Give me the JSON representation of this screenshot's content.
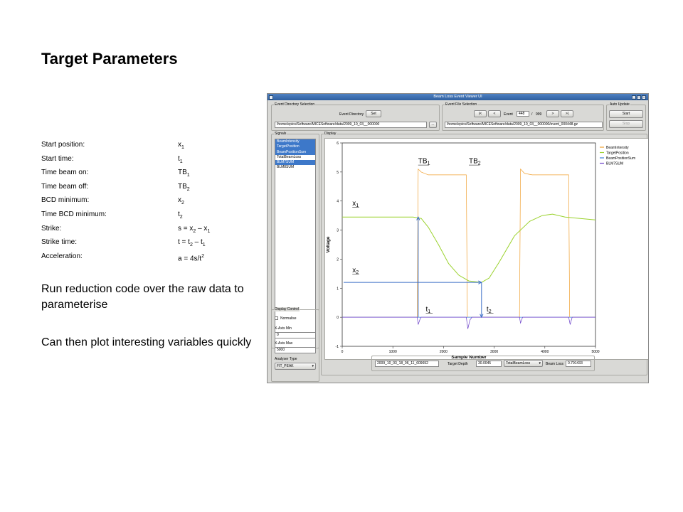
{
  "slide": {
    "title": "Target Parameters",
    "parameters": [
      {
        "label": "Start position:",
        "value": "x1"
      },
      {
        "label": "Start time:",
        "value": "t1"
      },
      {
        "label": "Time beam on:",
        "value": "TB1"
      },
      {
        "label": "Time beam off:",
        "value": "TB2"
      },
      {
        "label": "BCD minimum:",
        "value": "x2"
      },
      {
        "label": "Time BCD minimum:",
        "value": "t2"
      },
      {
        "label": "Strike:",
        "value": "s = x2 – x1"
      },
      {
        "label": "Strike time:",
        "value": "t = t2 – t1"
      },
      {
        "label": "Acceleration:",
        "value": "a = 4s/t2"
      }
    ],
    "note_run": "Run reduction code over the raw data to parameterise",
    "note_plot": "Can then plot interesting variables quickly"
  },
  "app": {
    "window_title": "Beam Loss Event Viewer UI",
    "event_directory": {
      "group_label": "Event Directory Selection",
      "label": "Event Directory",
      "set_button": "Set",
      "path": "/home/epics/Software/MICESoftware/data/2009_10_03__000000",
      "browse_button": "..."
    },
    "event_file": {
      "group_label": "Event File Selection",
      "first_button": "|<",
      "prev_button": "<",
      "event_label": "Event",
      "event_number": "448",
      "separator": "/",
      "event_total": "999",
      "next_button": ">",
      "last_button": ">|",
      "path": "/home/epics/Software/MICESoftware/data/2009_10_03__000000/event_000448.gz",
      "browse_button": "..."
    },
    "auto_update": {
      "group_label": "Auto Update",
      "start_button": "Start",
      "stop_button": "Stop"
    },
    "signals": {
      "group_label": "Signals",
      "items": [
        "BeamIntensity",
        "TargetPosition",
        "BeamPositionSum",
        "TotalBeamLoss",
        "BLM7SUM",
        "BLM8SUM"
      ],
      "selected": [
        "BeamIntensity",
        "TargetPosition",
        "BeamPositionSum",
        "BLM7SUM"
      ]
    },
    "display": {
      "group_label": "Display"
    },
    "display_control": {
      "group_label": "Display Control",
      "normalise_label": "Normalise",
      "normalise_checked": false,
      "xmin_label": "X-Axis Min",
      "xmin_value": "0",
      "xmax_label": "X-Axis Max",
      "xmax_value": "5000",
      "analyser_label": "Analyser Type",
      "analyser_value": "FIT_PEAK"
    },
    "status": {
      "timestamp": "2009_10_03_18_06_11_609652",
      "target_depth_label": "Target Depth",
      "target_depth_value": "30.0045",
      "loss_select": "TotalBeamLoss",
      "beam_loss_label": "Beam Loss",
      "beam_loss_value": "0.791433"
    }
  },
  "chart_data": {
    "type": "line",
    "xlabel": "Sample Number",
    "ylabel": "Voltage",
    "xlim": [
      0,
      5000
    ],
    "ylim": [
      -1,
      6
    ],
    "xticks": [
      "0",
      "1000",
      "2000",
      "3000",
      "4000",
      "5000"
    ],
    "yticks": [
      "-1",
      "0",
      "1",
      "2",
      "3",
      "4",
      "5",
      "6"
    ],
    "legend_position": "top-right",
    "series": [
      {
        "name": "BeamIntensity",
        "color": "#f0a030",
        "points": [
          [
            0,
            0
          ],
          [
            1480,
            0
          ],
          [
            1500,
            5.1
          ],
          [
            1560,
            5.0
          ],
          [
            1700,
            4.9
          ],
          [
            2450,
            4.9
          ],
          [
            2470,
            0
          ],
          [
            3500,
            0
          ],
          [
            3520,
            5.1
          ],
          [
            3600,
            4.95
          ],
          [
            3750,
            4.9
          ],
          [
            4470,
            4.9
          ],
          [
            4490,
            0
          ],
          [
            5000,
            0
          ]
        ]
      },
      {
        "name": "TargetPosition",
        "color": "#9bd22e",
        "points": [
          [
            0,
            3.45
          ],
          [
            1000,
            3.45
          ],
          [
            1400,
            3.45
          ],
          [
            1560,
            3.4
          ],
          [
            1700,
            3.1
          ],
          [
            1900,
            2.5
          ],
          [
            2100,
            1.85
          ],
          [
            2300,
            1.45
          ],
          [
            2500,
            1.25
          ],
          [
            2750,
            1.2
          ],
          [
            2900,
            1.35
          ],
          [
            3100,
            1.9
          ],
          [
            3400,
            2.8
          ],
          [
            3700,
            3.3
          ],
          [
            3950,
            3.5
          ],
          [
            4150,
            3.55
          ],
          [
            4400,
            3.45
          ],
          [
            4700,
            3.4
          ],
          [
            5000,
            3.35
          ]
        ]
      },
      {
        "name": "BeamPositionSum",
        "color": "#3a7fd8",
        "points": [
          [
            0,
            0
          ],
          [
            5000,
            0
          ]
        ]
      },
      {
        "name": "BLM7SUM",
        "color": "#6a3fc8",
        "points": [
          [
            0,
            0
          ],
          [
            1480,
            0
          ],
          [
            1500,
            -0.25
          ],
          [
            1540,
            -0.05
          ],
          [
            1560,
            0
          ],
          [
            2450,
            0
          ],
          [
            2480,
            -0.4
          ],
          [
            2520,
            -0.1
          ],
          [
            2560,
            0
          ],
          [
            3500,
            0
          ],
          [
            3520,
            -0.2
          ],
          [
            3560,
            0
          ],
          [
            4470,
            0
          ],
          [
            4500,
            -0.25
          ],
          [
            4540,
            0
          ],
          [
            5000,
            0
          ]
        ]
      }
    ],
    "annotations": [
      {
        "label": "TB1",
        "x": 1500,
        "y": 5.3
      },
      {
        "label": "TB2",
        "x": 2500,
        "y": 5.3
      },
      {
        "label": "x1",
        "x": 200,
        "y": 3.85
      },
      {
        "label": "x2",
        "x": 200,
        "y": 1.55
      },
      {
        "label": "t1",
        "x": 1650,
        "y": 0.2
      },
      {
        "label": "t2",
        "x": 2850,
        "y": 0.2
      }
    ]
  }
}
